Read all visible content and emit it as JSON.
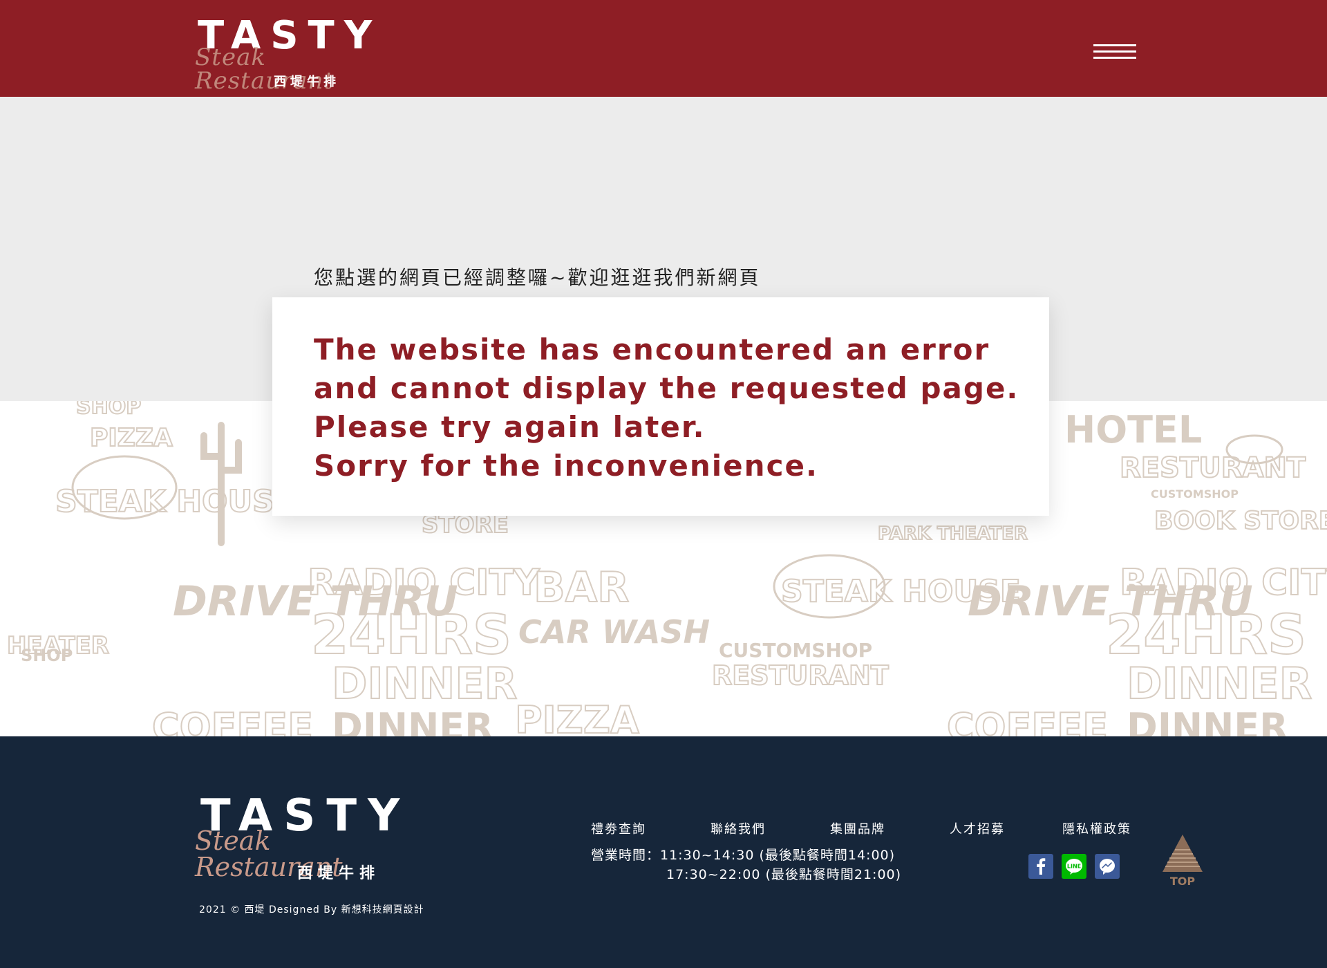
{
  "header": {
    "logo_word": "TASTY",
    "logo_script": "Steak Restaurant",
    "logo_cn": "西堤牛排",
    "menu_icon": "hamburger-menu-icon"
  },
  "main": {
    "notice": "您點選的網頁已經調整囉~歡迎逛逛我們新網頁",
    "error_lines": [
      "The website has encountered an error",
      "and cannot display the requested page.",
      "Please try again later.",
      "Sorry for the inconvenience."
    ]
  },
  "pattern_words": [
    "SHOP",
    "PIZZA",
    "STEAK HOUSE",
    "HOTEL",
    "RESTURANT",
    "CUSTOMSHOP",
    "BOOK STORE",
    "STORE",
    "PARK THEATER",
    "RADIO CITY",
    "BAR",
    "DRIVE THRU",
    "24HRS",
    "CAR WASH",
    "DINNER",
    "COFFEE",
    "HEATER",
    "TOP"
  ],
  "footer": {
    "logo_word": "TASTY",
    "logo_script": "Steak Restaurant",
    "logo_cn": "西堤牛排",
    "copyright": "2021 © 西堤 Designed By 新想科技網頁設計",
    "links": [
      "禮劵查詢",
      "聯絡我們",
      "集團品牌",
      "人才招募",
      "隱私權政策"
    ],
    "hours_line1": "營業時間：11:30~14:30 (最後點餐時間14:00)",
    "hours_line2": "17:30~22:00 (最後點餐時間21:00)",
    "social": [
      "facebook-icon",
      "line-icon",
      "messenger-icon"
    ],
    "top_label": "TOP"
  },
  "colors": {
    "brand_red": "#8e1e25",
    "footer_navy": "#16263a",
    "pattern_beige": "#d8cdc2",
    "top_bronze": "#a07c62"
  }
}
